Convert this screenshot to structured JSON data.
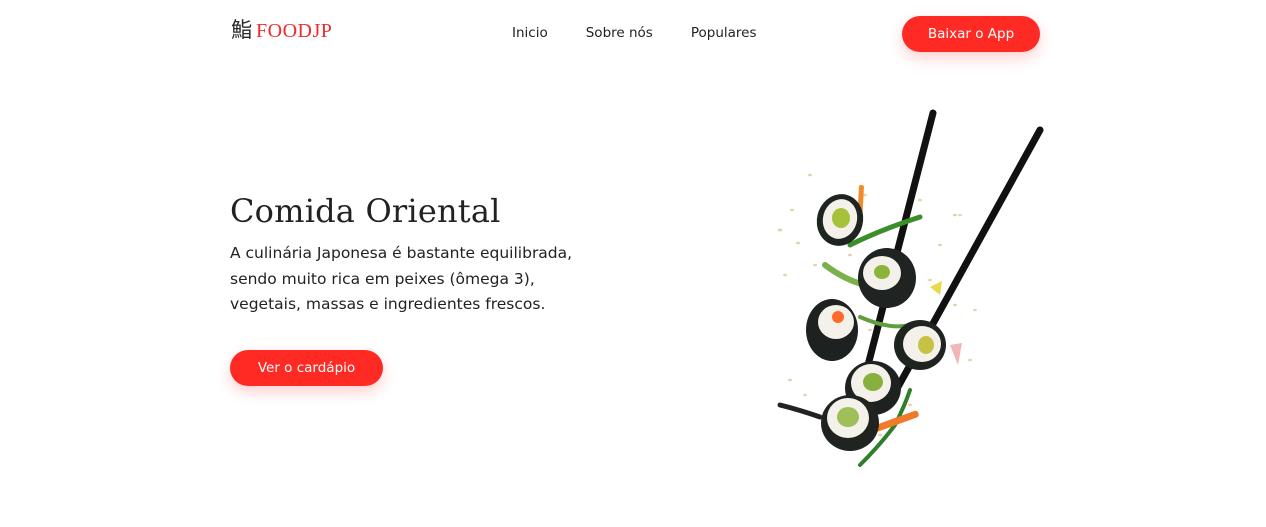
{
  "header": {
    "logo": {
      "glyph": "鮨",
      "text": "FOODJP"
    },
    "nav": [
      {
        "label": "Inicio"
      },
      {
        "label": "Sobre nós"
      },
      {
        "label": "Populares"
      }
    ],
    "cta_label": "Baixar o App"
  },
  "hero": {
    "title": "Comida Oriental",
    "description": "A culinária Japonesa é bastante equilibrada, sendo muito rica em peixes (ômega 3), vegetais, massas e ingredientes frescos.",
    "button_label": "Ver o cardápio",
    "image_icon": "sushi-chopsticks-illustration"
  },
  "colors": {
    "accent": "#ff2a24",
    "logo_text": "#ef2b2b",
    "text": "#222222",
    "background": "#ffffff"
  }
}
